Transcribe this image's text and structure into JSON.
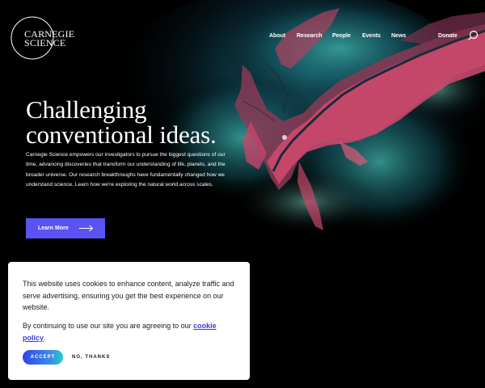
{
  "brand": {
    "line1": "CARNEGIE",
    "line2": "SCIENCE"
  },
  "nav": {
    "items": [
      {
        "label": "About"
      },
      {
        "label": "Research"
      },
      {
        "label": "People"
      },
      {
        "label": "Events"
      },
      {
        "label": "News"
      },
      {
        "label": "Donate"
      }
    ],
    "search_icon": "search-icon"
  },
  "hero": {
    "headline_line1": "Challenging",
    "headline_line2": "conventional ideas.",
    "intro": "Carnegie Science empowers our investigators to pursue the biggest questions of our time, advancing discoveries that transform our understanding of life, planets, and the broader universe. Our research breakthroughs have fundamentally changed how we understand science. Learn how we're exploring the natural world across scales.",
    "cta_label": "Learn More",
    "cta_icon": "arrow-right-icon"
  },
  "cookie_banner": {
    "message": "This website uses cookies to enhance content, analyze traffic and serve advertising, ensuring you get the best experience on our website.",
    "consent_prefix": "By continuing to use our site you are agreeing to our ",
    "link_label": "cookie policy",
    "consent_suffix": ".",
    "accept_label": "ACCEPT",
    "decline_label": "NO, THANKS"
  },
  "colors": {
    "cta_background": "#5a52f2",
    "link": "#3b3fd8",
    "accept_gradient_start": "#2f45e8",
    "accept_gradient_end": "#21d0c8"
  }
}
